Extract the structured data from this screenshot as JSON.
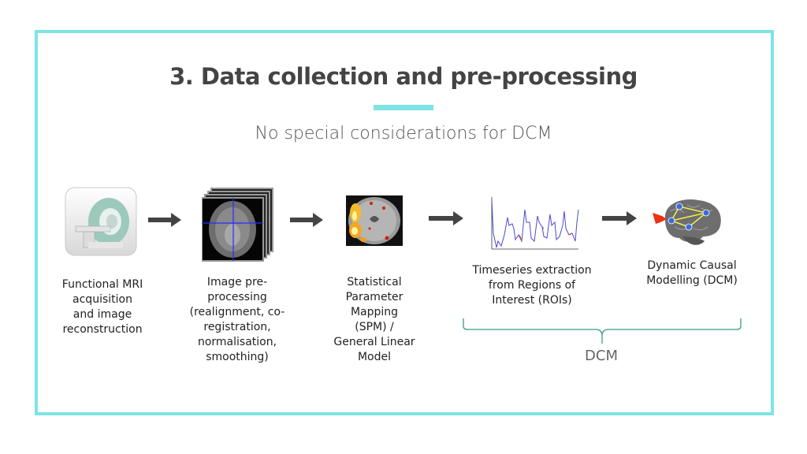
{
  "slide": {
    "title": "3. Data collection and pre-processing",
    "subtitle": "No special considerations for DCM",
    "accent_color": "#7fe3e3"
  },
  "steps": [
    {
      "icon": "mri-scanner-icon",
      "caption_lines": [
        "Functional MRI",
        "acquisition",
        "and image",
        "reconstruction"
      ]
    },
    {
      "icon": "brain-slices-stack-icon",
      "caption_lines": [
        "Image pre-",
        "processing",
        "(realignment, co-",
        "registration,",
        "normalisation,",
        "smoothing)"
      ]
    },
    {
      "icon": "spm-activation-map-icon",
      "caption_lines": [
        "Statistical",
        "Parameter",
        "Mapping",
        "(SPM) /",
        "General Linear",
        "Model"
      ]
    },
    {
      "icon": "timeseries-plot-icon",
      "caption_lines": [
        "Timeseries extraction",
        "from Regions of",
        "Interest (ROIs)"
      ]
    },
    {
      "icon": "dcm-brain-network-icon",
      "caption_lines": [
        "Dynamic Causal",
        "Modelling (DCM)"
      ]
    }
  ],
  "brace": {
    "label": "DCM",
    "color": "#3a9a8a"
  }
}
